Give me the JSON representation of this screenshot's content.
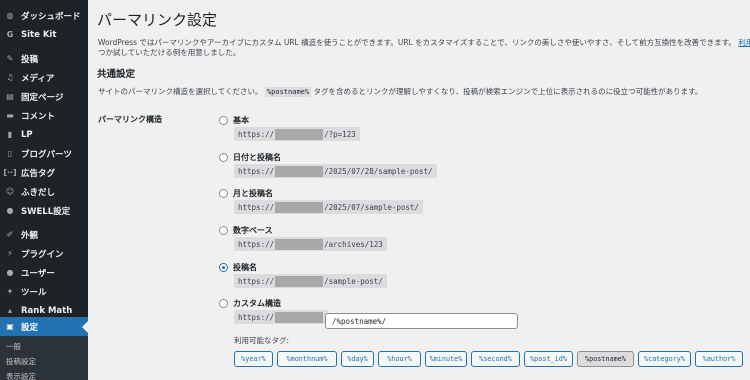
{
  "sidebar": {
    "items": [
      {
        "label": "ダッシュボード",
        "icon": "dashboard-icon",
        "glyph": "◍"
      },
      {
        "label": "Site Kit",
        "icon": "sitekit-icon",
        "glyph": "G"
      },
      {
        "label": "投稿",
        "icon": "pin-icon",
        "glyph": "✎"
      },
      {
        "label": "メディア",
        "icon": "media-icon",
        "glyph": "♫"
      },
      {
        "label": "固定ページ",
        "icon": "page-icon",
        "glyph": "▤"
      },
      {
        "label": "コメント",
        "icon": "comment-icon",
        "glyph": "▬"
      },
      {
        "label": "LP",
        "icon": "lp-icon",
        "glyph": "▮"
      },
      {
        "label": "ブログパーツ",
        "icon": "blogparts-icon",
        "glyph": "▯"
      },
      {
        "label": "広告タグ",
        "icon": "adtag-icon",
        "glyph": "[··]"
      },
      {
        "label": "ふきだし",
        "icon": "balloon-icon",
        "glyph": "☺"
      },
      {
        "label": "SWELL設定",
        "icon": "swell-icon",
        "glyph": "●"
      },
      {
        "label": "外観",
        "icon": "appearance-icon",
        "glyph": "✐"
      },
      {
        "label": "プラグイン",
        "icon": "plugin-icon",
        "glyph": "⚡"
      },
      {
        "label": "ユーザー",
        "icon": "user-icon",
        "glyph": "●"
      },
      {
        "label": "ツール",
        "icon": "tool-icon",
        "glyph": "✦"
      },
      {
        "label": "Rank Math",
        "icon": "rankmath-icon",
        "glyph": "▴"
      },
      {
        "label": "設定",
        "icon": "settings-icon",
        "glyph": "▣"
      }
    ],
    "submenu": [
      "一般",
      "投稿設定",
      "表示設定"
    ]
  },
  "page": {
    "title": "パーマリンク設定",
    "intro_line1": "WordPress ではパーマリンクやアーカイブにカスタム URL 構造を使うことができます。URL をカスタマイズすることで、リンクの美しさや使いやすさ、そして前方互換性を改善できます。",
    "intro_link": "利用できるタグ",
    "intro_line2": "つか試していただける例を用意しました。",
    "section_title": "共通設定",
    "section_desc_before": "サイトのパーマリンク構造を選択してください。",
    "section_desc_code": "%postname%",
    "section_desc_after": " タグを含めるとリンクが理解しやすくなり、投稿が検索エンジンで上位に表示されるのに役立つ可能性があります。",
    "row_label": "パーマリンク構造"
  },
  "options": [
    {
      "label": "基本",
      "prefix": "https://",
      "suffix": "/?p=123",
      "checked": false
    },
    {
      "label": "日付と投稿名",
      "prefix": "https://",
      "suffix": "/2025/07/28/sample-post/",
      "checked": false
    },
    {
      "label": "月と投稿名",
      "prefix": "https://",
      "suffix": "/2025/07/sample-post/",
      "checked": false
    },
    {
      "label": "数字ベース",
      "prefix": "https://",
      "suffix": "/archives/123",
      "checked": false
    },
    {
      "label": "投稿名",
      "prefix": "https://",
      "suffix": "/sample-post/",
      "checked": true
    },
    {
      "label": "カスタム構造",
      "prefix": "https://",
      "suffix": "",
      "checked": false
    }
  ],
  "custom": {
    "value": "/%postname%/",
    "tags_label": "利用可能なタグ:",
    "tags": [
      "%year%",
      "%monthnum%",
      "%day%",
      "%hour%",
      "%minute%",
      "%second%",
      "%post_id%",
      "%postname%",
      "%category%",
      "%author%"
    ],
    "active_tag": "%postname%"
  },
  "colors": {
    "accent": "#2271b1",
    "sidebar_bg": "#1d2327",
    "page_bg": "#f0f0f1"
  }
}
